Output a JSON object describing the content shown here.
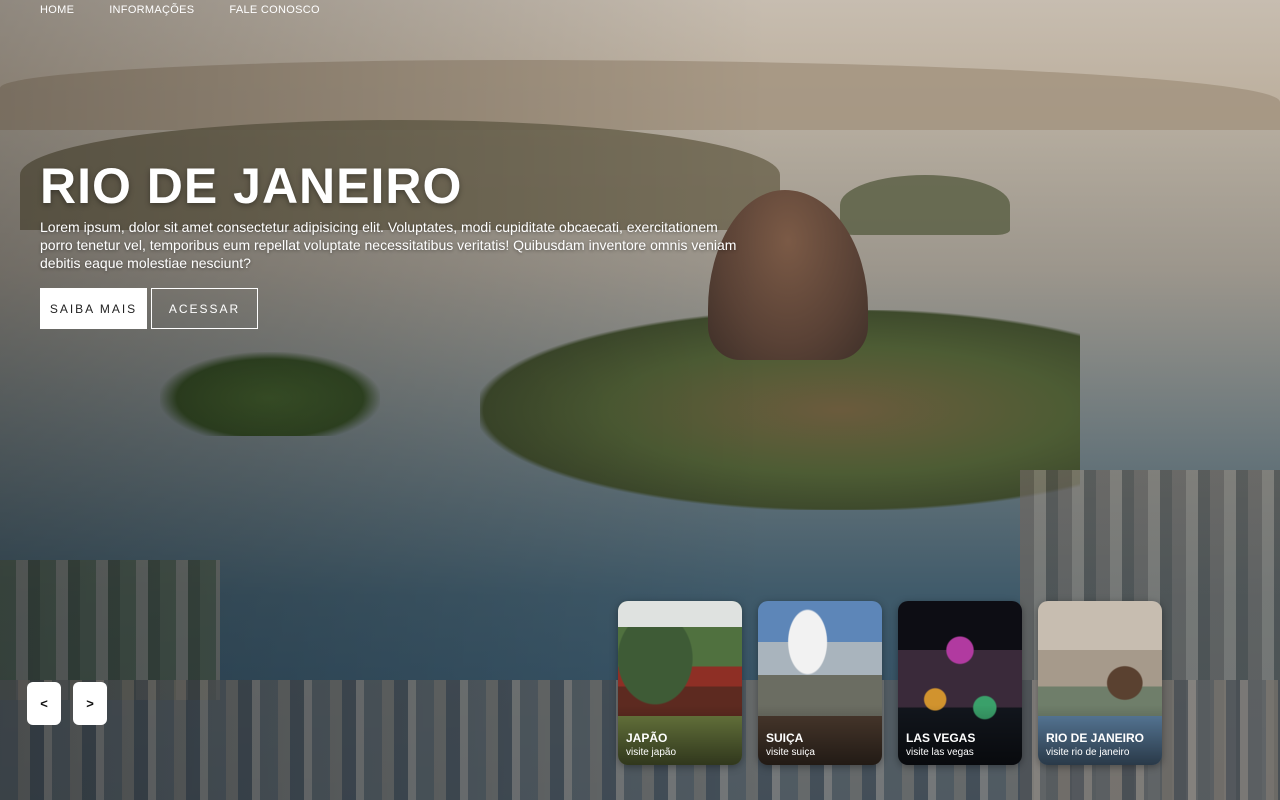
{
  "nav": {
    "items": [
      {
        "label": "HOME"
      },
      {
        "label": "INFORMAÇÕES"
      },
      {
        "label": "FALE CONOSCO"
      }
    ]
  },
  "hero": {
    "title": "RIO DE JANEIRO",
    "description": "Lorem ipsum, dolor sit amet consectetur adipisicing elit. Voluptates, modi cupiditate obcaecati, exercitationem porro tenetur vel, temporibus eum repellat voluptate necessitatibus veritatis! Quibusdam inventore omnis veniam debitis eaque molestiae nesciunt?",
    "primary_button": "SAIBA MAIS",
    "secondary_button": "ACESSAR"
  },
  "slider": {
    "prev": "<",
    "next": ">"
  },
  "cards": [
    {
      "title": "JAPÃO",
      "subtitle": "visite japão"
    },
    {
      "title": "SUIÇA",
      "subtitle": "visite suiça"
    },
    {
      "title": "LAS VEGAS",
      "subtitle": "visite las vegas"
    },
    {
      "title": "RIO DE JANEIRO",
      "subtitle": "visite rio de janeiro"
    }
  ]
}
